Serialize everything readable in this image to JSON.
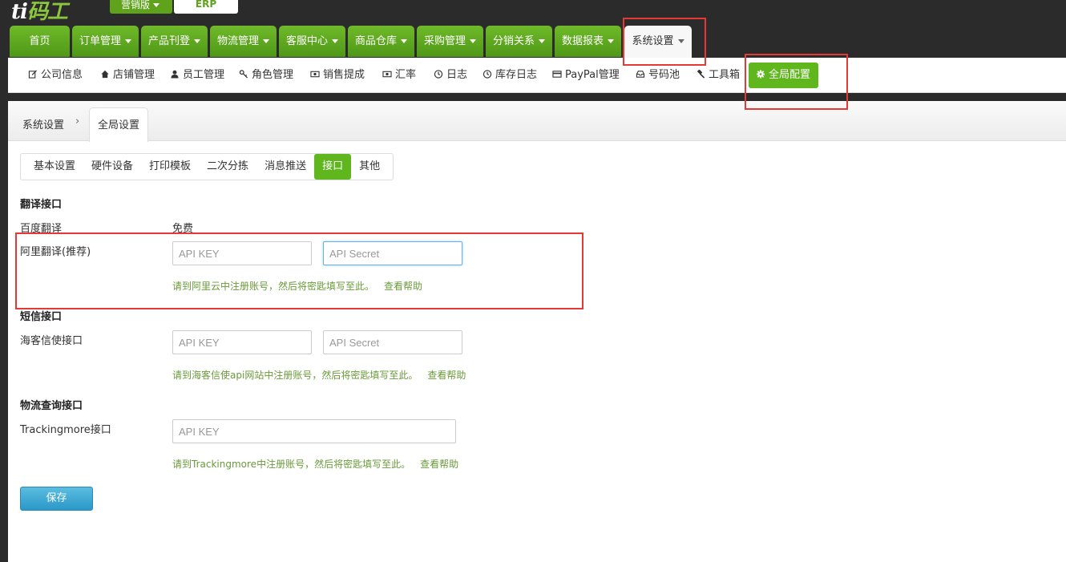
{
  "brand": {
    "logo_text_a": "ti",
    "logo_text_b": "码工",
    "edition": "营销版",
    "erp": "ERP"
  },
  "main_nav": [
    {
      "label": "首页",
      "caret": false
    },
    {
      "label": "订单管理",
      "caret": true
    },
    {
      "label": "产品刊登",
      "caret": true
    },
    {
      "label": "物流管理",
      "caret": true
    },
    {
      "label": "客服中心",
      "caret": true
    },
    {
      "label": "商品仓库",
      "caret": true
    },
    {
      "label": "采购管理",
      "caret": true
    },
    {
      "label": "分销关系",
      "caret": true
    },
    {
      "label": "数据报表",
      "caret": true
    },
    {
      "label": "系统设置",
      "caret": true,
      "active": true
    }
  ],
  "sub_nav": [
    {
      "label": "公司信息",
      "icon": "edit-icon"
    },
    {
      "label": "店铺管理",
      "icon": "home-icon"
    },
    {
      "label": "员工管理",
      "icon": "user-icon"
    },
    {
      "label": "角色管理",
      "icon": "key-icon"
    },
    {
      "label": "销售提成",
      "icon": "money-icon"
    },
    {
      "label": "汇率",
      "icon": "money-icon"
    },
    {
      "label": "日志",
      "icon": "clock-icon"
    },
    {
      "label": "库存日志",
      "icon": "clock-icon"
    },
    {
      "label": "PayPal管理",
      "icon": "credit-card-icon"
    },
    {
      "label": "号码池",
      "icon": "inbox-icon"
    },
    {
      "label": "工具箱",
      "icon": "gavel-icon"
    },
    {
      "label": "全局配置",
      "icon": "gear-icon",
      "active": true
    }
  ],
  "breadcrumb": {
    "root": "系统设置",
    "separator": "›",
    "current": "全局设置"
  },
  "tabs": [
    "基本设置",
    "硬件设备",
    "打印模板",
    "二次分拣",
    "消息推送",
    "接口",
    "其他"
  ],
  "active_tab": "接口",
  "sections": {
    "translate": {
      "title": "翻译接口",
      "baidu_label": "百度翻译",
      "baidu_value": "免费",
      "ali_label": "阿里翻译(推荐)",
      "key_placeholder": "API KEY",
      "secret_placeholder": "API Secret",
      "hint_pre": "请到",
      "hint_link": "阿里云",
      "hint_post": "中注册账号，然后将密匙填写至此。",
      "help": "查看帮助"
    },
    "sms": {
      "title": "短信接口",
      "label": "海客信使接口",
      "key_placeholder": "API KEY",
      "secret_placeholder": "API Secret",
      "hint_pre": "请到",
      "hint_link": "海客信使api网站",
      "hint_post": "中注册账号，然后将密匙填写至此。",
      "help": "查看帮助"
    },
    "logistics": {
      "title": "物流查询接口",
      "label": "Trackingmore接口",
      "key_placeholder": "API KEY",
      "hint_pre": "请到",
      "hint_link": "Trackingmore",
      "hint_post": "中注册账号，然后将密匙填写至此。",
      "help": "查看帮助"
    }
  },
  "save_label": "保存",
  "colors": {
    "accent_green": "#5fb61d",
    "nav_green": "#5fa31d",
    "save_blue": "#2a98c7",
    "highlight_red": "#e53935",
    "hint_green": "#6a9a3a"
  }
}
